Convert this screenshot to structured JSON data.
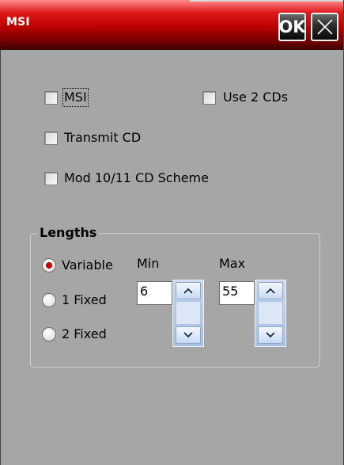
{
  "title": "MSI",
  "buttons": {
    "ok": "OK",
    "close_icon": "close-x-icon"
  },
  "checkboxes": {
    "msi": {
      "label": "MSI",
      "checked": false
    },
    "use2cds": {
      "label": "Use 2 CDs",
      "checked": false
    },
    "transmit_cd": {
      "label": "Transmit CD",
      "checked": false
    },
    "mod_scheme": {
      "label": "Mod 10/11 CD Scheme",
      "checked": false
    }
  },
  "lengths": {
    "title": "Lengths",
    "options": [
      {
        "label": "Variable",
        "selected": true
      },
      {
        "label": "1 Fixed",
        "selected": false
      },
      {
        "label": "2 Fixed",
        "selected": false
      }
    ],
    "min": {
      "label": "Min",
      "value": "6"
    },
    "max": {
      "label": "Max",
      "value": "55"
    }
  },
  "colors": {
    "title_bar": "#b80000",
    "background": "#a6a6a6",
    "radio_selected": "#c00000"
  }
}
